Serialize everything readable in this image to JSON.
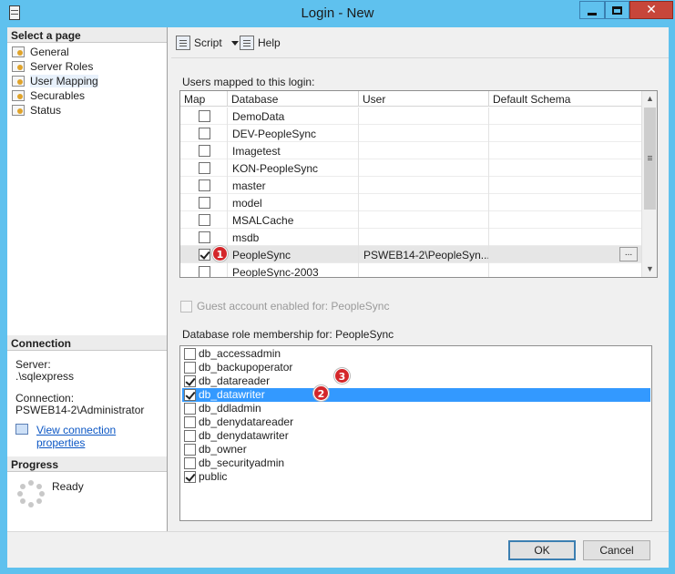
{
  "window": {
    "title": "Login - New",
    "close_glyph": "✕"
  },
  "left": {
    "select_page_header": "Select a page",
    "pages": [
      {
        "label": "General",
        "selected": false
      },
      {
        "label": "Server Roles",
        "selected": false
      },
      {
        "label": "User Mapping",
        "selected": true
      },
      {
        "label": "Securables",
        "selected": false
      },
      {
        "label": "Status",
        "selected": false
      }
    ],
    "connection_header": "Connection",
    "server_label": "Server:",
    "server_value": ".\\sqlexpress",
    "connection_label": "Connection:",
    "connection_value": "PSWEB14-2\\Administrator",
    "view_connection_link": "View connection properties",
    "progress_header": "Progress",
    "progress_status": "Ready"
  },
  "toolbar": {
    "script_label": "Script",
    "help_label": "Help"
  },
  "users_mapped": {
    "label": "Users mapped to this login:",
    "columns": [
      "Map",
      "Database",
      "User",
      "Default Schema"
    ],
    "rows": [
      {
        "map": false,
        "database": "DemoData",
        "user": "",
        "schema": ""
      },
      {
        "map": false,
        "database": "DEV-PeopleSync",
        "user": "",
        "schema": ""
      },
      {
        "map": false,
        "database": "Imagetest",
        "user": "",
        "schema": ""
      },
      {
        "map": false,
        "database": "KON-PeopleSync",
        "user": "",
        "schema": ""
      },
      {
        "map": false,
        "database": "master",
        "user": "",
        "schema": ""
      },
      {
        "map": false,
        "database": "model",
        "user": "",
        "schema": ""
      },
      {
        "map": false,
        "database": "MSALCache",
        "user": "",
        "schema": ""
      },
      {
        "map": false,
        "database": "msdb",
        "user": "",
        "schema": ""
      },
      {
        "map": true,
        "database": "PeopleSync",
        "user": "PSWEB14-2\\PeopleSyn...",
        "schema": "",
        "selected": true
      },
      {
        "map": false,
        "database": "PeopleSync-2003",
        "user": "",
        "schema": ""
      }
    ],
    "ellipsis": "...",
    "scroll_up": "▲",
    "scroll_down": "▼"
  },
  "guest": {
    "label": "Guest account enabled for: PeopleSync",
    "checked": false
  },
  "roles": {
    "label": "Database role membership for: PeopleSync",
    "items": [
      {
        "label": "db_accessadmin",
        "checked": false
      },
      {
        "label": "db_backupoperator",
        "checked": false
      },
      {
        "label": "db_datareader",
        "checked": true
      },
      {
        "label": "db_datawriter",
        "checked": true,
        "selected": true
      },
      {
        "label": "db_ddladmin",
        "checked": false
      },
      {
        "label": "db_denydatareader",
        "checked": false
      },
      {
        "label": "db_denydatawriter",
        "checked": false
      },
      {
        "label": "db_owner",
        "checked": false
      },
      {
        "label": "db_securityadmin",
        "checked": false
      },
      {
        "label": "public",
        "checked": true
      }
    ]
  },
  "badges": {
    "one": "1",
    "two": "2",
    "three": "3",
    "color": "#d4262a"
  },
  "buttons": {
    "ok": "OK",
    "cancel": "Cancel"
  }
}
